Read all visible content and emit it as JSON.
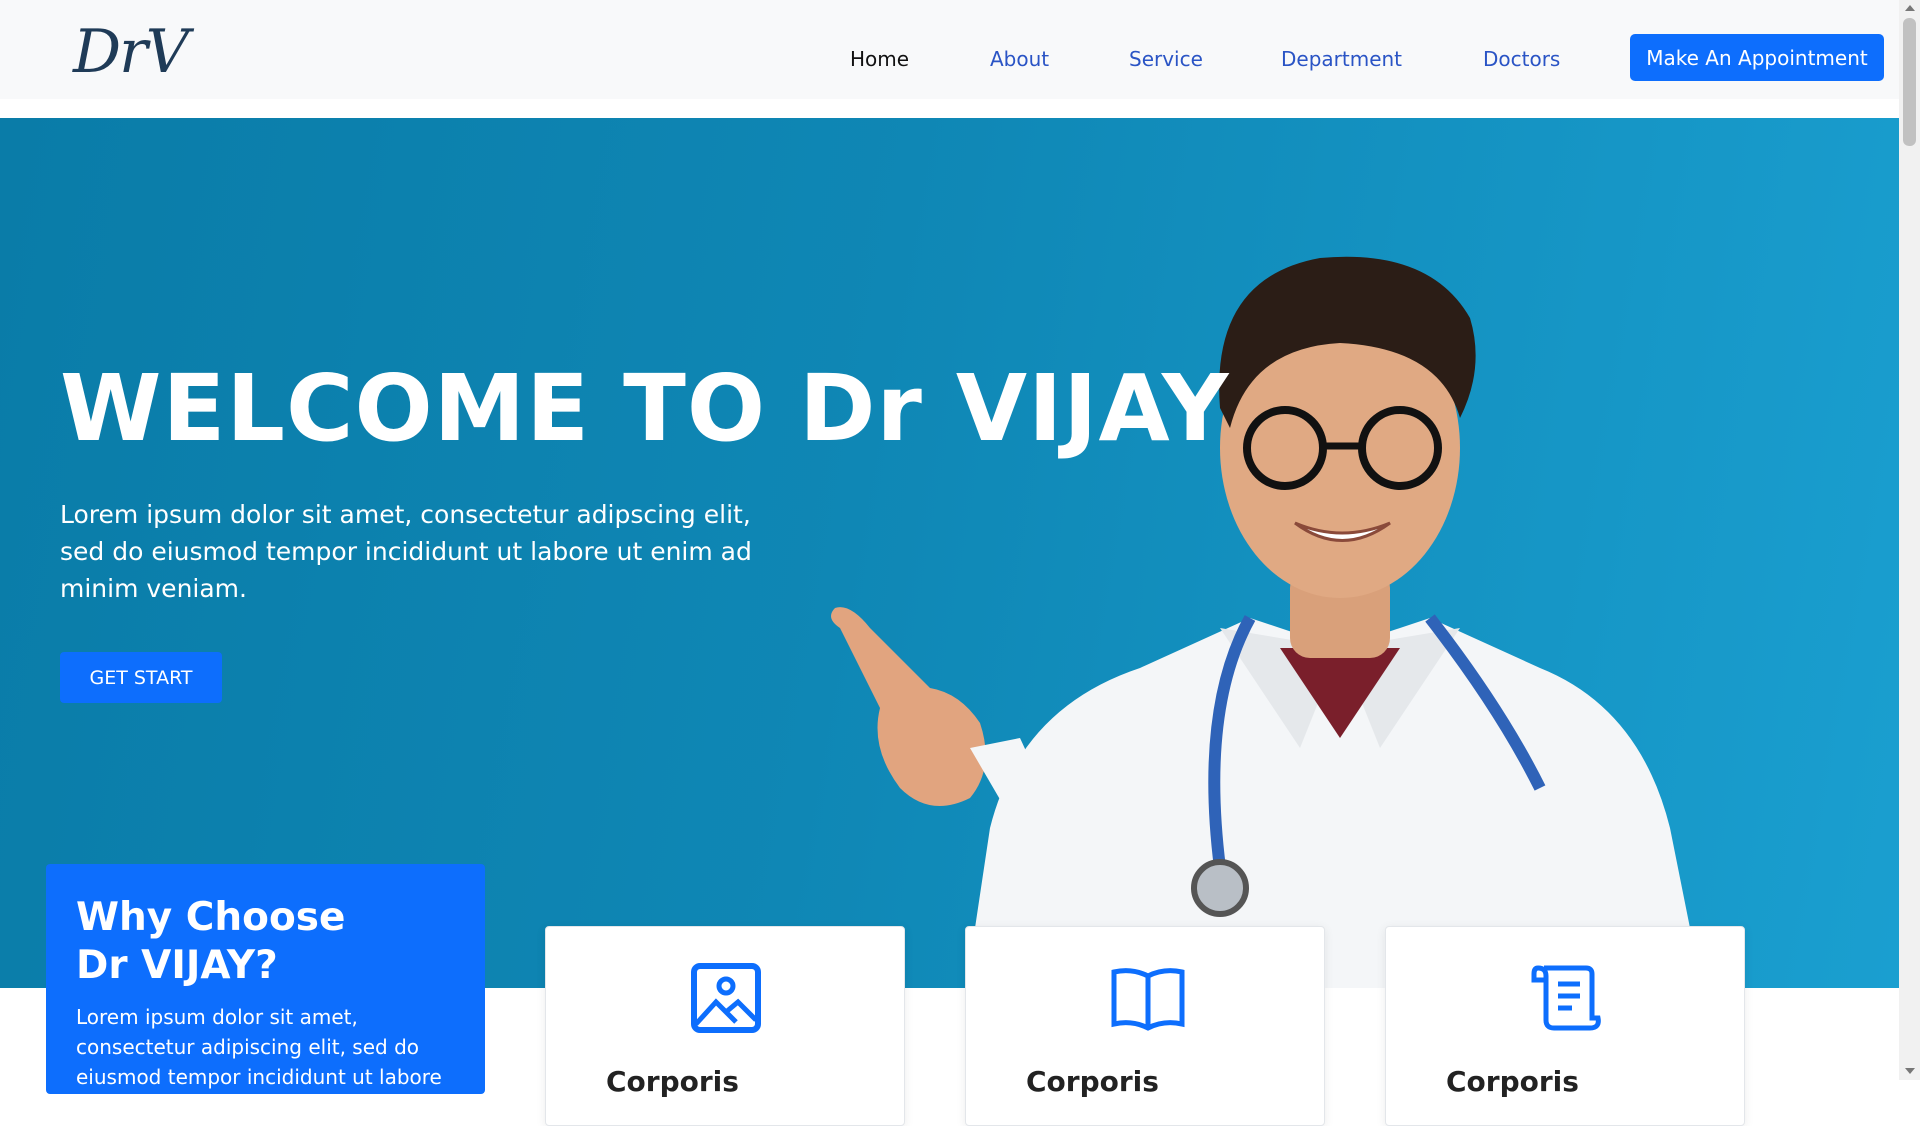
{
  "brand": {
    "logo_text": "DrV"
  },
  "nav": {
    "items": [
      {
        "label": "Home"
      },
      {
        "label": "About"
      },
      {
        "label": "Service"
      },
      {
        "label": "Department"
      },
      {
        "label": "Doctors"
      }
    ],
    "cta_label": "Make An Appointment"
  },
  "hero": {
    "title": "WELCOME TO Dr VIJAY",
    "text": "Lorem ipsum dolor sit amet, consectetur adipscing elit, sed do eiusmod tempor incididunt ut labore ut enim ad minim veniam.",
    "button_label": "GET START"
  },
  "why": {
    "title": "Why Choose Dr VIJAY?",
    "text": "Lorem ipsum dolor sit amet, consectetur adipiscing elit, sed do eiusmod tempor incididunt ut labore"
  },
  "cards": [
    {
      "icon": "image-icon",
      "title": "Corporis"
    },
    {
      "icon": "book-icon",
      "title": "Corporis"
    },
    {
      "icon": "scroll-icon",
      "title": "Corporis"
    }
  ],
  "colors": {
    "primary": "#0d6efd",
    "hero_bg": "#0f87b5",
    "nav_link": "#2a54c5",
    "logo": "#1f3b57"
  }
}
